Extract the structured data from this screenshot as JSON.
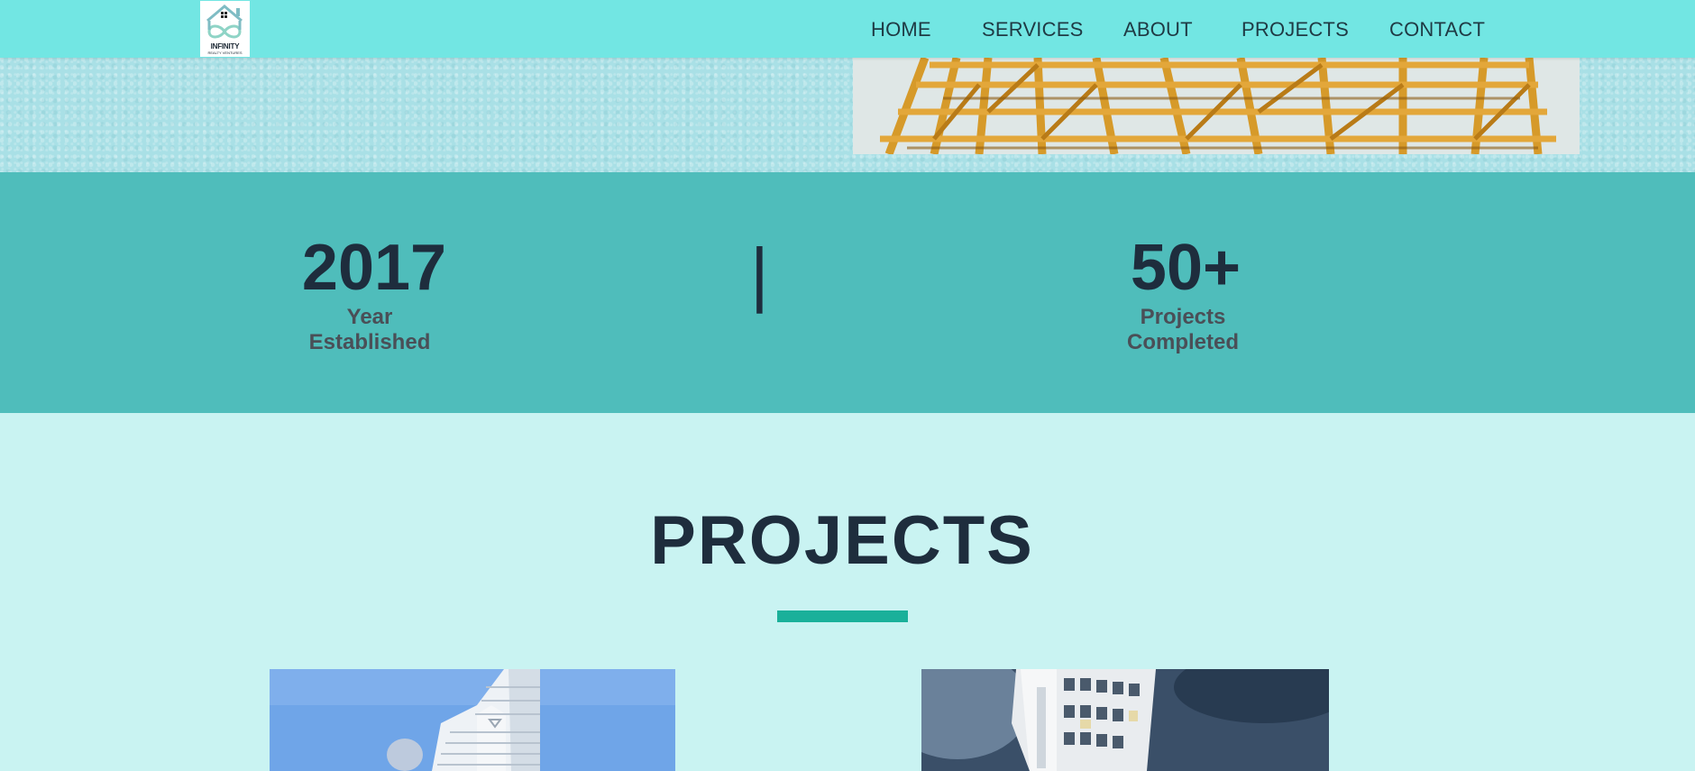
{
  "logo": {
    "name": "INFINITY",
    "tagline": "REALTY VENTURES"
  },
  "nav": {
    "items": [
      "HOME",
      "SERVICES",
      "ABOUT",
      "PROJECTS",
      "CONTACT"
    ]
  },
  "stats": {
    "divider": "|",
    "items": [
      {
        "number": "2017",
        "label_line1": "Year",
        "label_line2": "Established"
      },
      {
        "number": "50+",
        "label_line1": "Projects",
        "label_line2": "Completed"
      }
    ]
  },
  "projects": {
    "title": "PROJECTS"
  },
  "colors": {
    "navbar": "#72e6e3",
    "stats_band": "#4fbdbb",
    "page_background": "#c9f3f2",
    "accent_underline": "#1ab09a",
    "heading_text": "#1e2d3d"
  },
  "icons": {
    "logo_icon": "house-infinity-logo-icon"
  }
}
